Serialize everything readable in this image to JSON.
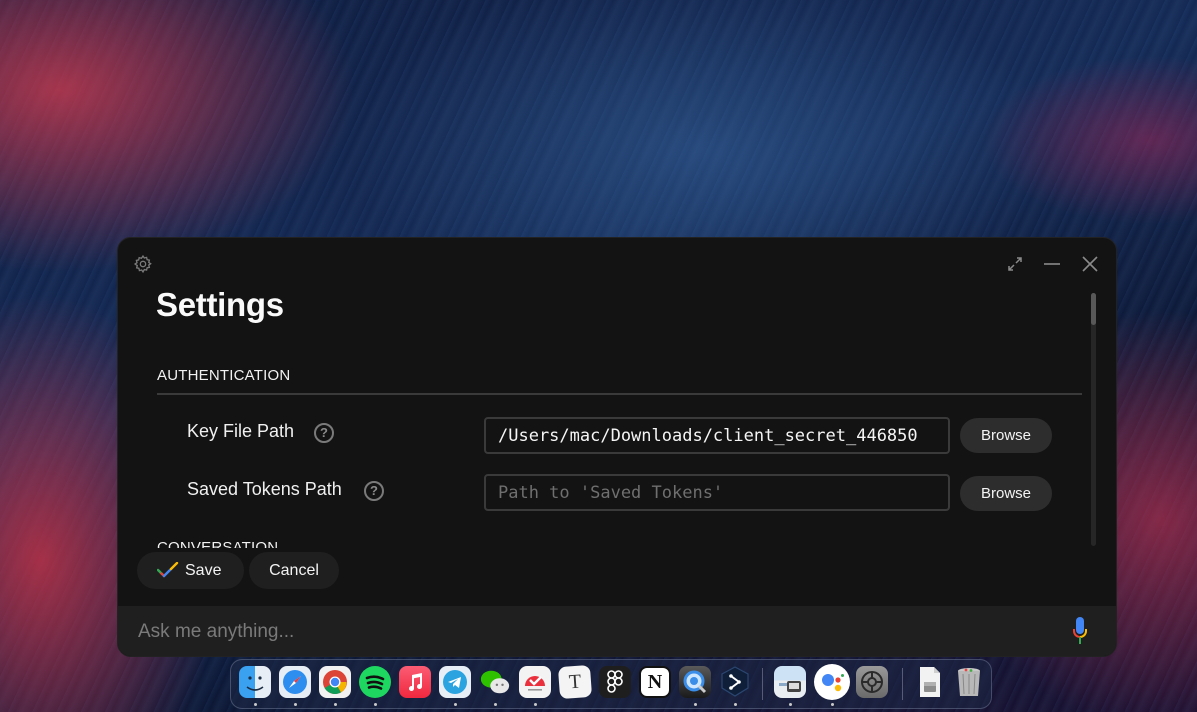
{
  "window": {
    "title": "Settings",
    "controls": {
      "expand": "expand",
      "minimize": "minimize",
      "close": "close"
    }
  },
  "sections": [
    {
      "heading": "AUTHENTICATION",
      "rows": [
        {
          "label": "Key File Path",
          "help": "?",
          "value": "/Users/mac/Downloads/client_secret_446850",
          "placeholder": "",
          "button": "Browse"
        },
        {
          "label": "Saved Tokens Path",
          "help": "?",
          "value": "",
          "placeholder": "Path to 'Saved Tokens'",
          "button": "Browse"
        }
      ]
    },
    {
      "heading": "CONVERSATION"
    }
  ],
  "actions": {
    "save": "Save",
    "cancel": "Cancel"
  },
  "ask_bar": {
    "placeholder": "Ask me anything..."
  },
  "scroll": {
    "position_fraction": 0.0
  },
  "dock": {
    "apps": [
      {
        "name": "Finder",
        "running": true
      },
      {
        "name": "Safari",
        "running": true
      },
      {
        "name": "Chrome",
        "running": true
      },
      {
        "name": "Spotify",
        "running": true
      },
      {
        "name": "Music",
        "running": false
      },
      {
        "name": "Telegram",
        "running": true
      },
      {
        "name": "WeChat",
        "running": true
      },
      {
        "name": "Tasks",
        "running": true
      },
      {
        "name": "Typora",
        "running": false
      },
      {
        "name": "Figma",
        "running": false
      },
      {
        "name": "Notion",
        "running": false
      },
      {
        "name": "QuickTime Player",
        "running": true
      },
      {
        "name": "Share App",
        "running": true
      },
      {
        "name": "Preview",
        "running": true
      },
      {
        "name": "Google Assistant",
        "running": true
      },
      {
        "name": "System Preferences",
        "running": false
      },
      {
        "name": "Downloads",
        "running": false
      },
      {
        "name": "Trash",
        "running": false
      }
    ]
  },
  "colors": {
    "window_bg": "#131313",
    "button_bg": "#2d2d2d",
    "ask_bar_bg": "#1f1f1f",
    "google_blue": "#4285F4",
    "google_red": "#EA4335",
    "google_yellow": "#FBBC05",
    "google_green": "#34A853"
  }
}
